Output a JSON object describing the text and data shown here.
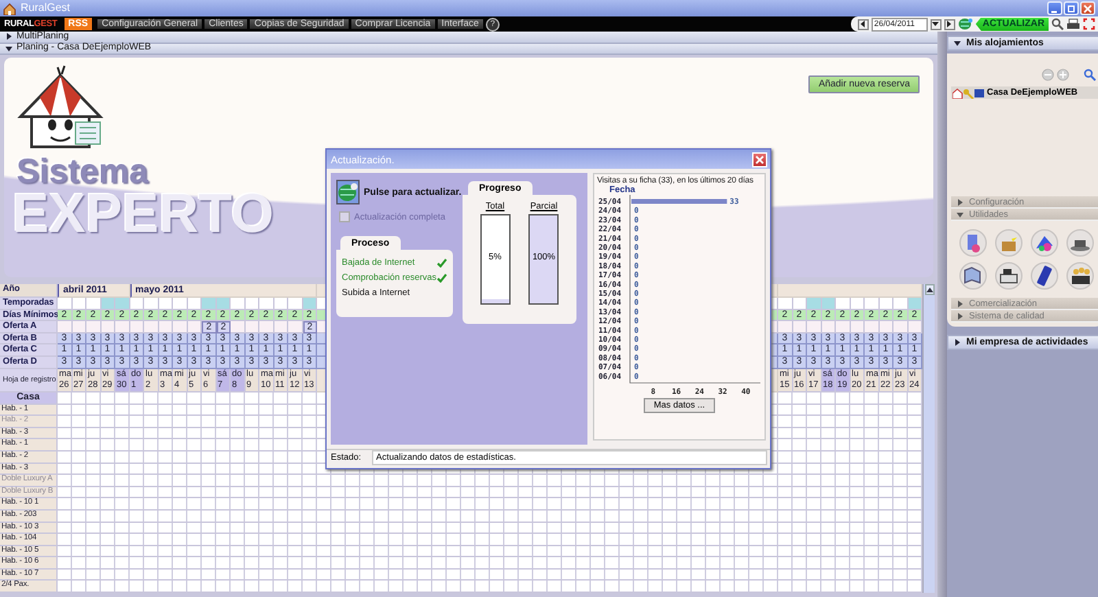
{
  "window": {
    "title": "RuralGest"
  },
  "menu": {
    "logo": [
      "RURAL",
      "GEST"
    ],
    "rss": "RSS",
    "items": [
      "Configuración General",
      "Clientes",
      "Copias de Seguridad",
      "Comprar Licencia",
      "Interface"
    ],
    "help": "?"
  },
  "toolbar": {
    "date": "26/04/2011",
    "update_button": "ACTUALIZAR"
  },
  "planing": {
    "sections": [
      {
        "label": "MultiPlaning",
        "expanded": false
      },
      {
        "label": "Planing - Casa DeEjemploWEB",
        "expanded": true
      }
    ],
    "banner": {
      "title_1": "Sistema",
      "title_2": "EXPERTO",
      "button": "Añadir nueva reserva"
    },
    "year_label": "Año",
    "row_labels": [
      "Temporadas",
      "Días Mínimos",
      "Oferta A",
      "Oferta B",
      "Oferta C",
      "Oferta D"
    ],
    "register_label": "Hoja de registro",
    "house_label": "Casa",
    "days_left": [
      {
        "weekday": "ma",
        "day": "26",
        "month": "abril 2011",
        "weekend": false,
        "season": false,
        "min_stay": "2",
        "offers": {
          "b": "3",
          "c": "1",
          "d": "3"
        }
      },
      {
        "weekday": "mi",
        "day": "27",
        "weekend": false,
        "season": false,
        "min_stay": "2",
        "offers": {
          "b": "3",
          "c": "1",
          "d": "3"
        }
      },
      {
        "weekday": "ju",
        "day": "28",
        "weekend": false,
        "season": false,
        "min_stay": "2",
        "offers": {
          "b": "3",
          "c": "1",
          "d": "3"
        }
      },
      {
        "weekday": "vi",
        "day": "29",
        "weekend": false,
        "season": true,
        "min_stay": "2",
        "offers": {
          "b": "3",
          "c": "1",
          "d": "3"
        }
      },
      {
        "weekday": "sá",
        "day": "30",
        "weekend": true,
        "season": true,
        "min_stay": "2",
        "offers": {
          "b": "3",
          "c": "1",
          "d": "3"
        }
      },
      {
        "weekday": "do",
        "day": "1",
        "month": "mayo 2011",
        "weekend": true,
        "season": false,
        "min_stay": "2",
        "offers": {
          "b": "3",
          "c": "1",
          "d": "3"
        }
      },
      {
        "weekday": "lu",
        "day": "2",
        "weekend": false,
        "season": false,
        "min_stay": "2",
        "offers": {
          "b": "3",
          "c": "1",
          "d": "3"
        }
      },
      {
        "weekday": "ma",
        "day": "3",
        "weekend": false,
        "season": false,
        "min_stay": "2",
        "offers": {
          "b": "3",
          "c": "1",
          "d": "3"
        }
      },
      {
        "weekday": "mi",
        "day": "4",
        "weekend": false,
        "season": false,
        "min_stay": "2",
        "offers": {
          "b": "3",
          "c": "1",
          "d": "3"
        }
      },
      {
        "weekday": "ju",
        "day": "5",
        "weekend": false,
        "season": false,
        "min_stay": "2",
        "offers": {
          "b": "3",
          "c": "1",
          "d": "3"
        }
      },
      {
        "weekday": "vi",
        "day": "6",
        "weekend": false,
        "season": true,
        "min_stay": "2",
        "offers": {
          "a": "2",
          "b": "3",
          "c": "1",
          "d": "3"
        }
      },
      {
        "weekday": "sá",
        "day": "7",
        "weekend": true,
        "season": true,
        "min_stay": "2",
        "offers": {
          "a": "2",
          "b": "3",
          "c": "1",
          "d": "3"
        }
      },
      {
        "weekday": "do",
        "day": "8",
        "weekend": true,
        "season": false,
        "min_stay": "2",
        "offers": {
          "b": "3",
          "c": "1",
          "d": "3"
        }
      },
      {
        "weekday": "lu",
        "day": "9",
        "weekend": false,
        "season": false,
        "min_stay": "2",
        "offers": {
          "b": "3",
          "c": "1",
          "d": "3"
        }
      },
      {
        "weekday": "ma",
        "day": "10",
        "weekend": false,
        "season": false,
        "min_stay": "2",
        "offers": {
          "b": "3",
          "c": "1",
          "d": "3"
        }
      },
      {
        "weekday": "mi",
        "day": "11",
        "weekend": false,
        "season": false,
        "min_stay": "2",
        "offers": {
          "b": "3",
          "c": "1",
          "d": "3"
        }
      },
      {
        "weekday": "ju",
        "day": "12",
        "weekend": false,
        "season": false,
        "min_stay": "2",
        "offers": {
          "b": "3",
          "c": "1",
          "d": "3"
        }
      },
      {
        "weekday": "vi",
        "day": "13",
        "weekend": false,
        "season": true,
        "min_stay": "2",
        "offers": {
          "a": "2",
          "b": "3",
          "c": "1",
          "d": "3"
        }
      }
    ],
    "days_right": [
      {
        "weekday": "mi",
        "day": "15",
        "weekend": false,
        "season": false,
        "min_stay": "2",
        "offers": {
          "b": "3",
          "c": "1",
          "d": "3"
        }
      },
      {
        "weekday": "ju",
        "day": "16",
        "weekend": false,
        "season": false,
        "min_stay": "2",
        "offers": {
          "b": "3",
          "c": "1",
          "d": "3"
        }
      },
      {
        "weekday": "vi",
        "day": "17",
        "weekend": false,
        "season": true,
        "min_stay": "2",
        "offers": {
          "b": "3",
          "c": "1",
          "d": "3"
        }
      },
      {
        "weekday": "sá",
        "day": "18",
        "weekend": true,
        "season": true,
        "min_stay": "2",
        "offers": {
          "b": "3",
          "c": "1",
          "d": "3"
        }
      },
      {
        "weekday": "do",
        "day": "19",
        "weekend": true,
        "season": false,
        "min_stay": "2",
        "offers": {
          "b": "3",
          "c": "1",
          "d": "3"
        }
      },
      {
        "weekday": "lu",
        "day": "20",
        "weekend": false,
        "season": false,
        "min_stay": "2",
        "offers": {
          "b": "3",
          "c": "1",
          "d": "3"
        }
      },
      {
        "weekday": "ma",
        "day": "21",
        "weekend": false,
        "season": false,
        "min_stay": "2",
        "offers": {
          "b": "3",
          "c": "1",
          "d": "3"
        }
      },
      {
        "weekday": "mi",
        "day": "22",
        "weekend": false,
        "season": false,
        "min_stay": "2",
        "offers": {
          "b": "3",
          "c": "1",
          "d": "3"
        }
      },
      {
        "weekday": "ju",
        "day": "23",
        "weekend": false,
        "season": false,
        "min_stay": "2",
        "offers": {
          "b": "3",
          "c": "1",
          "d": "3"
        }
      },
      {
        "weekday": "vi",
        "day": "24",
        "weekend": false,
        "season": true,
        "min_stay": "2",
        "offers": {
          "b": "3",
          "c": "1",
          "d": "3"
        }
      }
    ],
    "rooms": [
      {
        "name": "Hab. - 1",
        "disabled": false
      },
      {
        "name": "Hab. - 2",
        "disabled": true
      },
      {
        "name": "Hab. - 3",
        "disabled": false
      },
      {
        "name": "Hab. - 1",
        "disabled": false
      },
      {
        "name": "Hab. - 2",
        "disabled": false
      },
      {
        "name": "Hab. - 3",
        "disabled": false
      },
      {
        "name": "Doble Luxury A",
        "disabled": true
      },
      {
        "name": "Doble Luxury B",
        "disabled": true
      },
      {
        "name": "Hab. - 10 1",
        "disabled": false
      },
      {
        "name": "Hab. - 203",
        "disabled": false
      },
      {
        "name": "Hab. - 10 3",
        "disabled": false
      },
      {
        "name": "Hab. - 104",
        "disabled": false
      },
      {
        "name": "Hab. - 10 5",
        "disabled": false
      },
      {
        "name": "Hab. - 10 6",
        "disabled": false
      },
      {
        "name": "Hab. - 10 7",
        "disabled": false
      },
      {
        "name": "2/4 Pax.",
        "disabled": false
      }
    ]
  },
  "side": {
    "sections": [
      {
        "label": "Mis alojamientos",
        "expanded": true,
        "items": [
          {
            "label": "Casa DeEjemploWEB",
            "selected": true
          }
        ],
        "groups": [
          {
            "label": "Configuración",
            "expanded": false
          },
          {
            "label": "Utilidades",
            "expanded": true
          },
          {
            "label": "Comercialización",
            "expanded": false
          },
          {
            "label": "Sistema de calidad",
            "expanded": false
          }
        ]
      },
      {
        "label": "Mi empresa de actividades",
        "expanded": false
      }
    ]
  },
  "dialog": {
    "title": "Actualización.",
    "action_label": "Pulse para actualizar.",
    "full_update": {
      "label": "Actualización completa",
      "checked": false,
      "disabled": true
    },
    "process": {
      "title": "Proceso",
      "steps": [
        {
          "label": "Bajada de Internet",
          "done": true
        },
        {
          "label": "Comprobación reservas",
          "done": true
        },
        {
          "label": "Subida a Internet",
          "done": false
        }
      ]
    },
    "progress": {
      "title": "Progreso",
      "bars": [
        {
          "label": "Total",
          "level": 0.05,
          "reading": "5%"
        },
        {
          "label": "Parcial",
          "level": 1,
          "reading": "100%"
        }
      ]
    },
    "stats": {
      "chart_data": {
        "type": "bar",
        "orientation": "horizontal",
        "title": "Visitas a su ficha (33), en los últimos 20 días",
        "ylabel": "Fecha",
        "categories": [
          "25/04",
          "24/04",
          "23/04",
          "22/04",
          "21/04",
          "20/04",
          "19/04",
          "18/04",
          "17/04",
          "16/04",
          "15/04",
          "14/04",
          "13/04",
          "12/04",
          "11/04",
          "10/04",
          "09/04",
          "08/04",
          "07/04",
          "06/04"
        ],
        "values": [
          33,
          0,
          0,
          0,
          0,
          0,
          0,
          0,
          0,
          0,
          0,
          0,
          0,
          0,
          0,
          0,
          0,
          0,
          0,
          0
        ],
        "xlim": [
          0,
          45
        ],
        "xticks": [
          8,
          16,
          24,
          32,
          40
        ],
        "data_labels": true
      },
      "button": "Mas datos ..."
    },
    "status": {
      "label": "Estado:",
      "value": "Actualizando datos de estadísticas."
    }
  }
}
